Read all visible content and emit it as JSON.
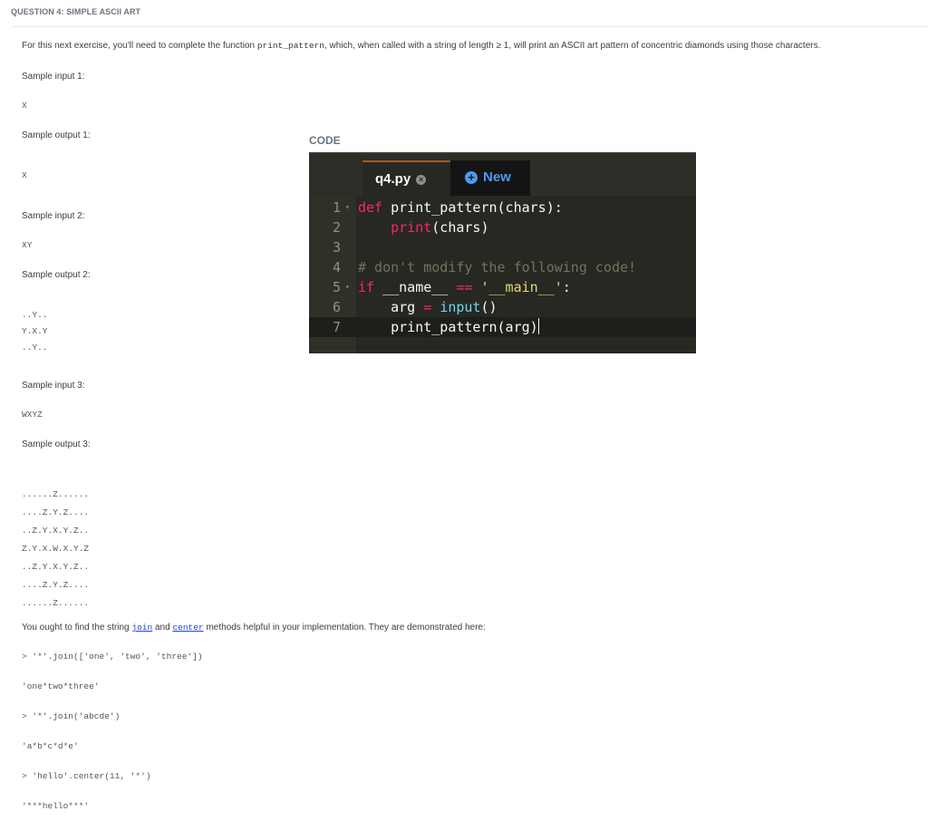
{
  "question": {
    "title": "QUESTION 4: SIMPLE ASCII ART",
    "intro_pre": "For this next exercise, you'll need to complete the function ",
    "intro_code": "print_pattern",
    "intro_post": ", which, when called with a string of length ≥ 1, will print an ASCII art pattern of concentric diamonds using those characters."
  },
  "samples": [
    {
      "input_label": "Sample input 1:",
      "input": "X",
      "output_label": "Sample output 1:",
      "output": [
        "X"
      ]
    },
    {
      "input_label": "Sample input 2:",
      "input": "XY",
      "output_label": "Sample output 2:",
      "output": [
        "..Y..",
        "Y.X.Y",
        "..Y.."
      ]
    },
    {
      "input_label": "Sample input 3:",
      "input": "WXYZ",
      "output_label": "Sample output 3:",
      "output": [
        "......Z......",
        "....Z.Y.Z....",
        "..Z.Y.X.Y.Z..",
        "Z.Y.X.W.X.Y.Z",
        "..Z.Y.X.Y.Z..",
        "....Z.Y.Z....",
        "......Z......"
      ]
    }
  ],
  "hint": {
    "pre": "You ought to find the string ",
    "link1": "join",
    "mid": " and ",
    "link2": "center",
    "post": " methods helpful in your implementation. They are demonstrated here:"
  },
  "demos": [
    "> '*'.join(['one', 'two', 'three'])",
    "'one*two*three'",
    "> '*'.join('abcde')",
    "'a*b*c*d*e'",
    "> 'hello'.center(11, '*')",
    "'***hello***'"
  ],
  "code_panel": {
    "label": "CODE",
    "tab_name": "q4.py",
    "close_icon": "×",
    "new_icon": "+",
    "new_label": "New",
    "line_numbers": [
      "1",
      "2",
      "3",
      "4",
      "5",
      "6",
      "7"
    ],
    "active_line": 7,
    "lines": [
      [
        {
          "t": "kw",
          "v": "def"
        },
        {
          "t": "fn",
          "v": " print_pattern(chars):"
        }
      ],
      [
        {
          "t": "fn",
          "v": "    "
        },
        {
          "t": "kw",
          "v": "print"
        },
        {
          "t": "fn",
          "v": "(chars)"
        }
      ],
      [],
      [
        {
          "t": "cm",
          "v": "# don't modify the following code!"
        }
      ],
      [
        {
          "t": "kw",
          "v": "if"
        },
        {
          "t": "fn",
          "v": " __name__ "
        },
        {
          "t": "op",
          "v": "=="
        },
        {
          "t": "fn",
          "v": " "
        },
        {
          "t": "str",
          "v": "'__main__'"
        },
        {
          "t": "fn",
          "v": ":"
        }
      ],
      [
        {
          "t": "fn",
          "v": "    arg "
        },
        {
          "t": "op",
          "v": "="
        },
        {
          "t": "fn",
          "v": " "
        },
        {
          "t": "bi",
          "v": "input"
        },
        {
          "t": "fn",
          "v": "()"
        }
      ],
      [
        {
          "t": "fn",
          "v": "    print_pattern(arg)"
        }
      ]
    ]
  }
}
